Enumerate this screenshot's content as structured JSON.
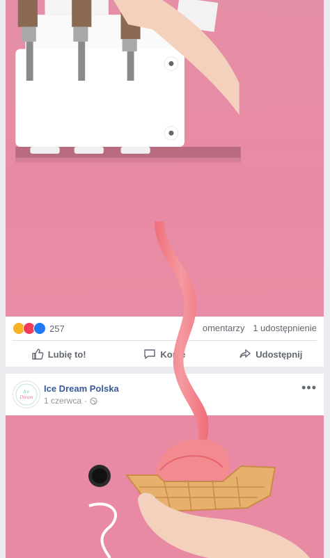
{
  "post1": {
    "reaction_count": "257",
    "comments_label": "omentarzy",
    "shares_label": "1 udostępnienie",
    "actions": {
      "like": "Lubię to!",
      "comment": "Kome",
      "share": "Udostępnij"
    }
  },
  "post2": {
    "page_name": "Ice Dream Polska",
    "date": "1 czerwca",
    "separator": "·",
    "more": "•••",
    "avatar_text": "Ice Dream"
  },
  "colors": {
    "pink_bg": "#e88aa3",
    "fb_blue": "#385898",
    "ice_cream": "#f28a8f"
  }
}
